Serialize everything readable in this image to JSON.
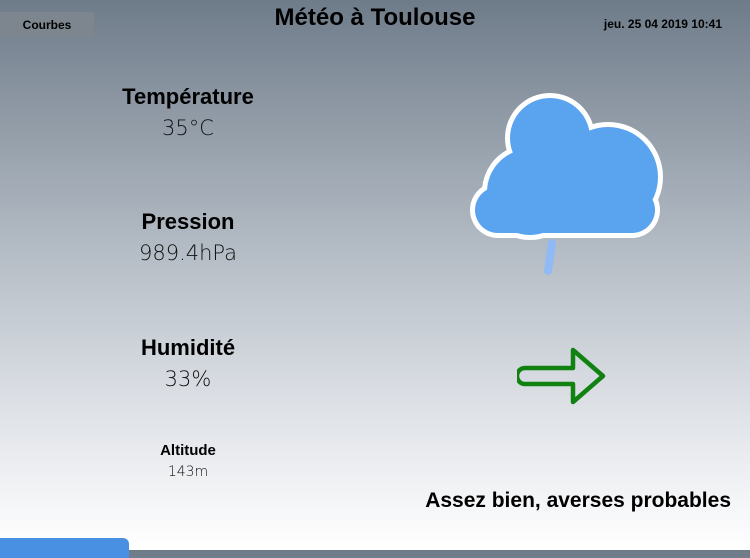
{
  "header": {
    "courbes_label": "Courbes",
    "title": "Météo à Toulouse",
    "datetime": "jeu. 25 04 2019 10:41"
  },
  "metrics": {
    "temperature": {
      "label": "Température",
      "value": "35°C"
    },
    "pressure": {
      "label": "Pression",
      "value": "989.4hPa"
    },
    "humidity": {
      "label": "Humidité",
      "value": "33%"
    },
    "altitude": {
      "label": "Altitude",
      "value": "143m"
    }
  },
  "icons": {
    "weather": "cloud-rain-icon",
    "trend": "arrow-right-icon"
  },
  "forecast": "Assez bien, averses probables",
  "colors": {
    "cloud_fill": "#5aa3ef",
    "rain": "#8fbaf5",
    "arrow": "#118211",
    "bottom_bar": "#4a90e2"
  }
}
